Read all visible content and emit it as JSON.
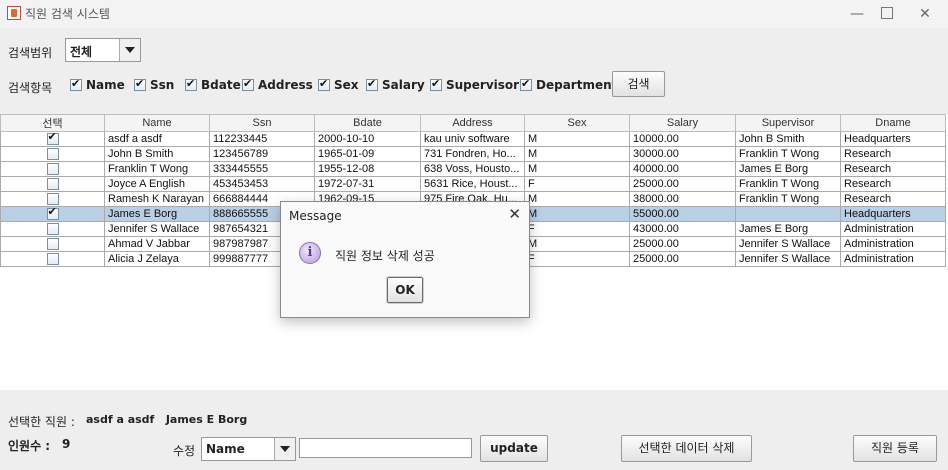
{
  "window": {
    "title": "직원 검색 시스템",
    "minimize": "—",
    "maximize": "",
    "close": "✕"
  },
  "search": {
    "range_label": "검색범위",
    "range_value": "전체",
    "fields_label": "검색항목",
    "fields": [
      {
        "label": "Name",
        "checked": true
      },
      {
        "label": "Ssn",
        "checked": true
      },
      {
        "label": "Bdate",
        "checked": true
      },
      {
        "label": "Address",
        "checked": true
      },
      {
        "label": "Sex",
        "checked": true
      },
      {
        "label": "Salary",
        "checked": true
      },
      {
        "label": "Supervisor",
        "checked": true
      },
      {
        "label": "Department",
        "checked": true
      }
    ],
    "search_button": "검색"
  },
  "table": {
    "columns": [
      "선택",
      "Name",
      "Ssn",
      "Bdate",
      "Address",
      "Sex",
      "Salary",
      "Supervisor",
      "Dname"
    ],
    "rows": [
      {
        "checked": true,
        "selected": false,
        "cells": [
          "asdf a asdf",
          "112233445",
          "2000-10-10",
          "kau univ software",
          "M",
          "10000.00",
          "John B Smith",
          "Headquarters"
        ]
      },
      {
        "checked": false,
        "selected": false,
        "cells": [
          "John B Smith",
          "123456789",
          "1965-01-09",
          "731 Fondren, Ho...",
          "M",
          "30000.00",
          "Franklin T Wong",
          "Research"
        ]
      },
      {
        "checked": false,
        "selected": false,
        "cells": [
          "Franklin T Wong",
          "333445555",
          "1955-12-08",
          "638 Voss, Housto...",
          "M",
          "40000.00",
          "James E Borg",
          "Research"
        ]
      },
      {
        "checked": false,
        "selected": false,
        "cells": [
          "Joyce A English",
          "453453453",
          "1972-07-31",
          "5631 Rice, Houst...",
          "F",
          "25000.00",
          "Franklin T Wong",
          "Research"
        ]
      },
      {
        "checked": false,
        "selected": false,
        "cells": [
          "Ramesh K Narayan",
          "666884444",
          "1962-09-15",
          "975 Fire Oak, Hu...",
          "M",
          "38000.00",
          "Franklin T Wong",
          "Research"
        ]
      },
      {
        "checked": true,
        "selected": true,
        "cells": [
          "James E Borg",
          "888665555",
          "",
          "",
          "M",
          "55000.00",
          "",
          "Headquarters"
        ]
      },
      {
        "checked": false,
        "selected": false,
        "cells": [
          "Jennifer S Wallace",
          "987654321",
          "",
          "",
          "F",
          "43000.00",
          "James E Borg",
          "Administration"
        ]
      },
      {
        "checked": false,
        "selected": false,
        "cells": [
          "Ahmad V Jabbar",
          "987987987",
          "",
          "",
          "M",
          "25000.00",
          "Jennifer S Wallace",
          "Administration"
        ]
      },
      {
        "checked": false,
        "selected": false,
        "cells": [
          "Alicia J Zelaya",
          "999887777",
          "",
          "",
          "F",
          "25000.00",
          "Jennifer S Wallace",
          "Administration"
        ]
      }
    ]
  },
  "footer": {
    "selected_label": "선택한 직원 :",
    "selected_names": "asdf a asdf   James E Borg",
    "count_label": "인원수 :",
    "count_value": "9",
    "edit_label": "수정",
    "edit_field": "Name",
    "edit_value": "",
    "update_button": "update",
    "delete_button": "선택한 데이터 삭제",
    "register_button": "직원 등록"
  },
  "dialog": {
    "title": "Message",
    "close": "✕",
    "icon": "info-icon",
    "icon_glyph": "i",
    "message": "직원 정보 삭제 성공",
    "ok_button": "OK"
  }
}
